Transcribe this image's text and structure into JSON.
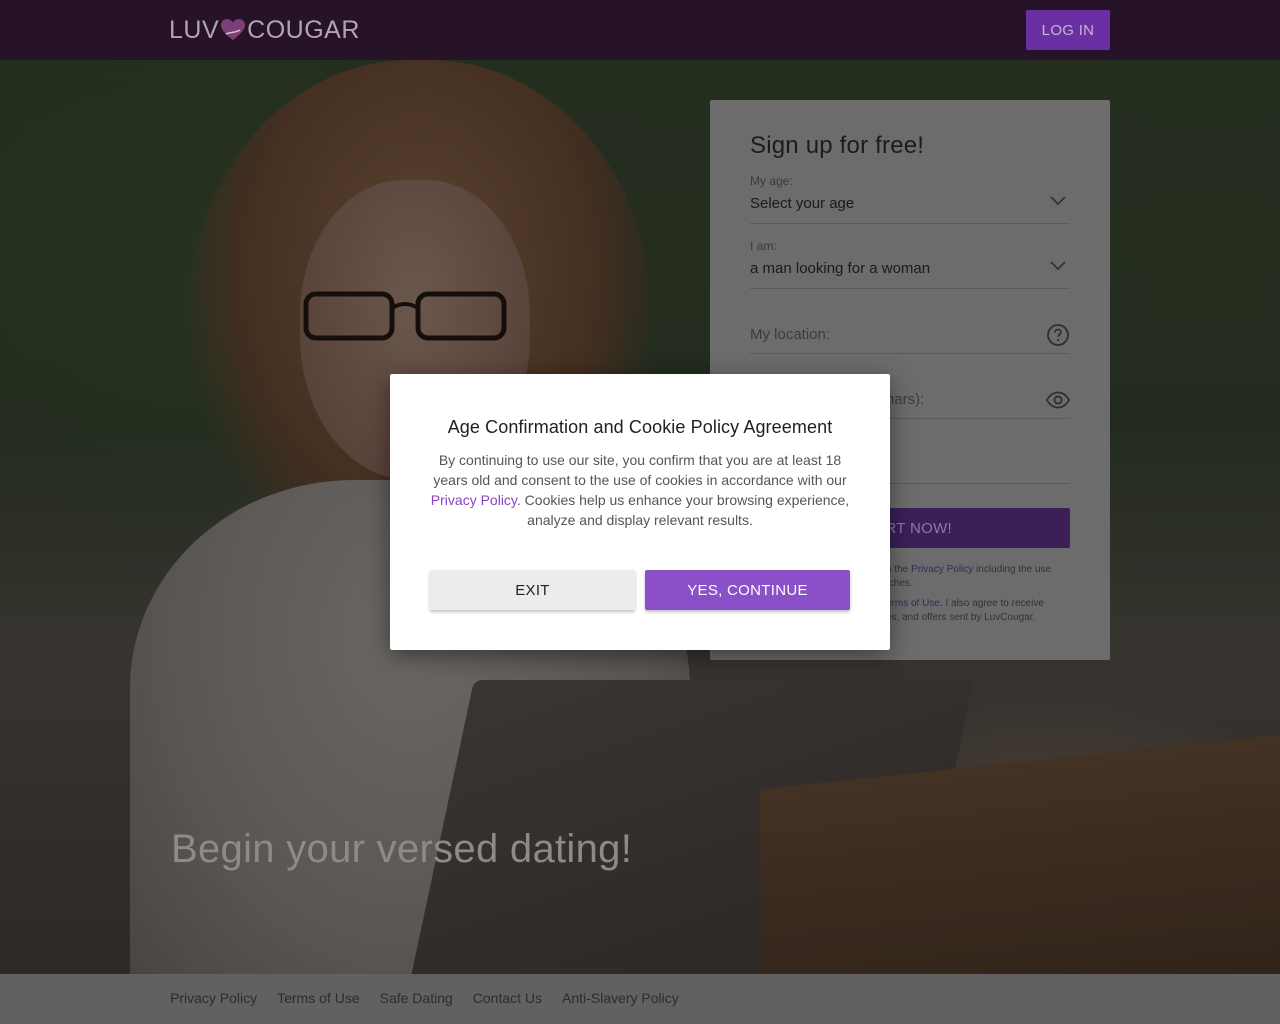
{
  "header": {
    "logo_left": "LUV",
    "logo_right": "COUGAR",
    "login_label": "LOG IN"
  },
  "hero": {
    "tagline": "Begin your versed dating!"
  },
  "signup": {
    "title": "Sign up for free!",
    "age_label": "My age:",
    "age_value": "Select your age",
    "iam_label": "I am:",
    "iam_value": "a man looking for a woman",
    "location_placeholder": "My location:",
    "password_placeholder_visible": "hars):",
    "start_label": "ART NOW!",
    "legal1_pre": "o the ",
    "legal1_link": "Privacy Policy",
    "legal1_post": " including the use",
    "legal1_line2": "tches.",
    "legal2_link": "erms of Use",
    "legal2_post": ". I also agree to receive",
    "legal2_line2": "es, and offers sent by LuvCougar."
  },
  "modal": {
    "title": "Age Confirmation and Cookie Policy Agreement",
    "text_before": "By continuing to use our site, you confirm that you are at least 18 years old and consent to the use of cookies in accordance with our ",
    "link": "Privacy Policy",
    "text_after": ". Cookies help us enhance your browsing experience, analyze and display relevant results.",
    "exit_label": "EXIT",
    "continue_label": "YES, CONTINUE"
  },
  "footer": {
    "links": [
      "Privacy Policy",
      "Terms of Use",
      "Safe Dating",
      "Contact Us",
      "Anti-Slavery Policy"
    ]
  },
  "colors": {
    "header_bg": "#271327",
    "accent": "#8b4fc7",
    "login_bg": "#6a2fa3"
  }
}
